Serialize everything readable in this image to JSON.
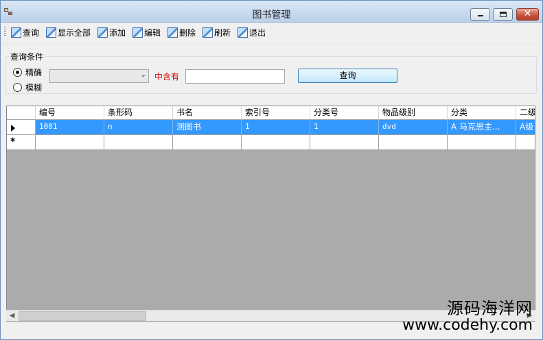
{
  "window": {
    "title": "图书管理"
  },
  "toolbar": {
    "items": [
      {
        "label": "查询",
        "icon": "picture-icon"
      },
      {
        "label": "显示全部",
        "icon": "picture-icon"
      },
      {
        "label": "添加",
        "icon": "picture-icon"
      },
      {
        "label": "编辑",
        "icon": "picture-icon"
      },
      {
        "label": "删除",
        "icon": "picture-icon"
      },
      {
        "label": "刷新",
        "icon": "picture-icon"
      },
      {
        "label": "退出",
        "icon": "picture-icon"
      }
    ]
  },
  "query": {
    "group_title": "查询条件",
    "mode_exact": "精确",
    "mode_fuzzy": "模糊",
    "selected_mode": "精确",
    "field_value": "",
    "contains_label": "中含有",
    "text_value": "",
    "button_label": "查询"
  },
  "grid": {
    "columns": [
      "编号",
      "条形码",
      "书名",
      "索引号",
      "分类号",
      "物品级别",
      "分类",
      "二级"
    ],
    "rows": [
      [
        "1001",
        "n",
        "测图书",
        "1",
        "1",
        "dvd",
        "A  马克思主...",
        "A级"
      ]
    ],
    "new_row_marker": "*"
  },
  "watermark": {
    "line1": "源码海洋网",
    "line2": "www.codehy.com"
  },
  "colors": {
    "selection": "#3399ff",
    "contains_label": "#d40000",
    "grid_background": "#ababab"
  }
}
